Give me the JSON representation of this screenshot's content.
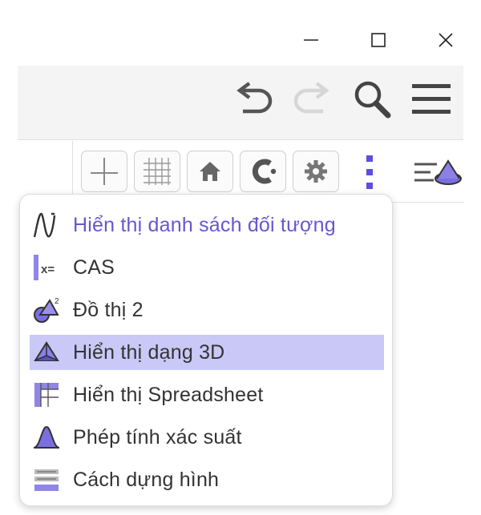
{
  "window_controls": {
    "minimize_icon": "minimize-icon",
    "maximize_icon": "maximize-icon",
    "close_icon": "close-icon"
  },
  "header": {
    "tools": [
      "undo-icon",
      "redo-icon",
      "search-icon",
      "menu-icon"
    ]
  },
  "style_bar": {
    "buttons": [
      "axes-icon",
      "grid-icon",
      "home-icon",
      "point-capture-icon",
      "settings-icon"
    ],
    "more_icon": "more-vertical-icon",
    "end_icon": "style-bar-toggle-icon"
  },
  "menu": {
    "items": [
      {
        "label": "Hiển thị danh sách đối tượng",
        "icon": "algebra-view-icon",
        "highlight": true
      },
      {
        "label": "CAS",
        "icon": "cas-icon"
      },
      {
        "label": "Đồ thị 2",
        "icon": "graphics2-icon"
      },
      {
        "label": "Hiển thị dạng 3D",
        "icon": "graphics3d-icon",
        "selected": true
      },
      {
        "label": "Hiển thị Spreadsheet",
        "icon": "spreadsheet-icon"
      },
      {
        "label": "Phép tính xác suất",
        "icon": "probability-icon"
      },
      {
        "label": "Cách dựng hình",
        "icon": "construction-protocol-icon"
      }
    ]
  },
  "colors": {
    "accent": "#6557d2",
    "selected_bg": "#c9c8f7",
    "icon_blue": "#6a5fd8",
    "kebab_blue": "#5b4fe0",
    "header_bg": "#f4f4f4"
  }
}
